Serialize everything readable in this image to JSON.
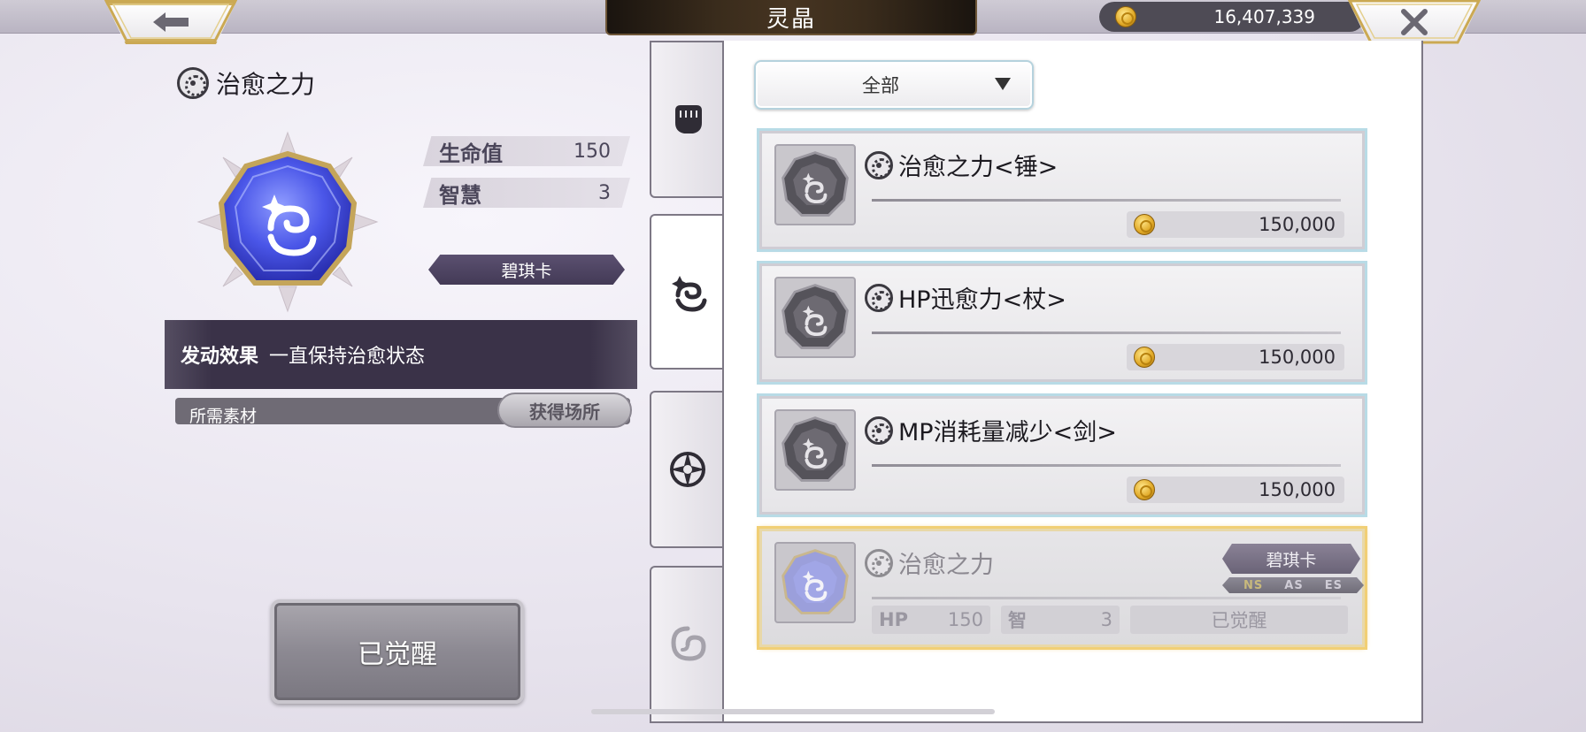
{
  "header": {
    "title": "灵晶",
    "gold": "16,407,339",
    "back_icon": "arrow-left-icon",
    "close_icon": "close-x-icon"
  },
  "detail": {
    "name": "治愈之力",
    "stats": [
      {
        "label": "生命值",
        "value": "150"
      },
      {
        "label": "智慧",
        "value": "3"
      }
    ],
    "card_type": "碧琪卡",
    "effect_label": "发动效果",
    "effect_text": "一直保持治愈状态",
    "materials_label": "所需素材",
    "obtain_button": "获得场所",
    "awaken_button": "已觉醒"
  },
  "tabs": [
    {
      "icon": "fist-icon",
      "active": false
    },
    {
      "icon": "sparkle-swirl-icon",
      "active": true
    },
    {
      "icon": "compass-star-icon",
      "active": false
    },
    {
      "icon": "vortex-icon",
      "active": false
    }
  ],
  "filter": {
    "label": "全部"
  },
  "crystals": [
    {
      "name": "治愈之力<锤>",
      "price": "150,000"
    },
    {
      "name": "HP迅愈力<杖>",
      "price": "150,000"
    },
    {
      "name": "MP消耗量减少<剑>",
      "price": "150,000"
    }
  ],
  "selected_crystal": {
    "name": "治愈之力",
    "card_type": "碧琪卡",
    "versions": [
      "NS",
      "AS",
      "ES"
    ],
    "hp_label": "HP",
    "hp_value": "150",
    "int_label": "智",
    "int_value": "3",
    "status": "已觉醒"
  },
  "colors": {
    "selected_border": "#f1cf75",
    "item_border": "#b8dbe6",
    "effect_bar": "#3a3248",
    "gem_blue": "#4a56e8"
  }
}
